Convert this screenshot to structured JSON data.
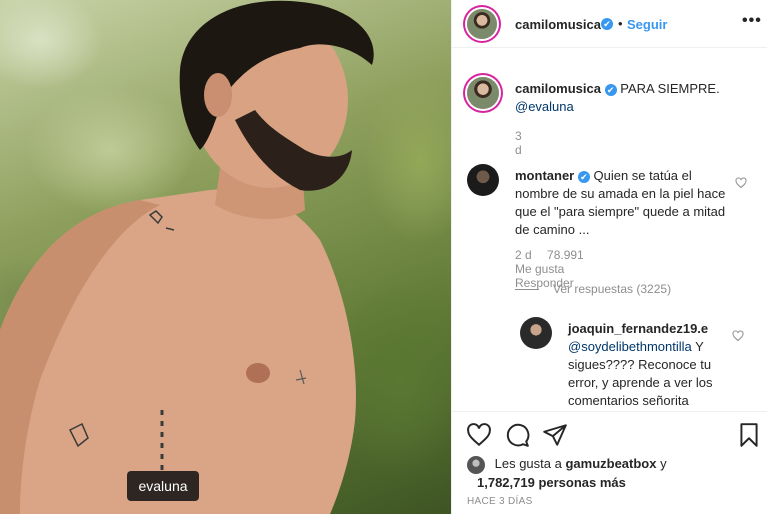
{
  "post": {
    "tag_label": "evaluna"
  },
  "header": {
    "username": "camilomusica",
    "verified_mark": "✔",
    "separator": "•",
    "follow_label": "Seguir",
    "more_label": "•••"
  },
  "caption": {
    "username": "camilomusica",
    "text": "PARA SIEMPRE.",
    "mention": "@evaluna",
    "age": "3 d"
  },
  "comments": [
    {
      "username": "montaner",
      "text": "Quien se tatúa el nombre de su amada en la piel hace que el \"para siempre\" quede a mitad de camino ...",
      "age": "2 d",
      "likes": "78.991 Me gusta",
      "reply_label": "Responder",
      "replies_label": "Ver respuestas (3225)"
    },
    {
      "username": "joaquin_fernandez19.e",
      "mention": "@soydelibethmontilla",
      "text": "Y sigues???? Reconoce tu error, y aprende a ver los comentarios señorita"
    }
  ],
  "likes_summary": {
    "prefix": "Les gusta a",
    "user": "gamuzbeatbox",
    "joiner": "y",
    "count": "1,782,719 personas más"
  },
  "timestamp": "HACE 3 DÍAS",
  "icons": [
    "heart-icon",
    "comment-icon",
    "share-icon",
    "bookmark-icon",
    "verified-icon",
    "more-icon"
  ],
  "colors": {
    "accent": "#3897f0",
    "mention": "#00376b",
    "muted": "#8e8e8e",
    "text": "#262626"
  }
}
